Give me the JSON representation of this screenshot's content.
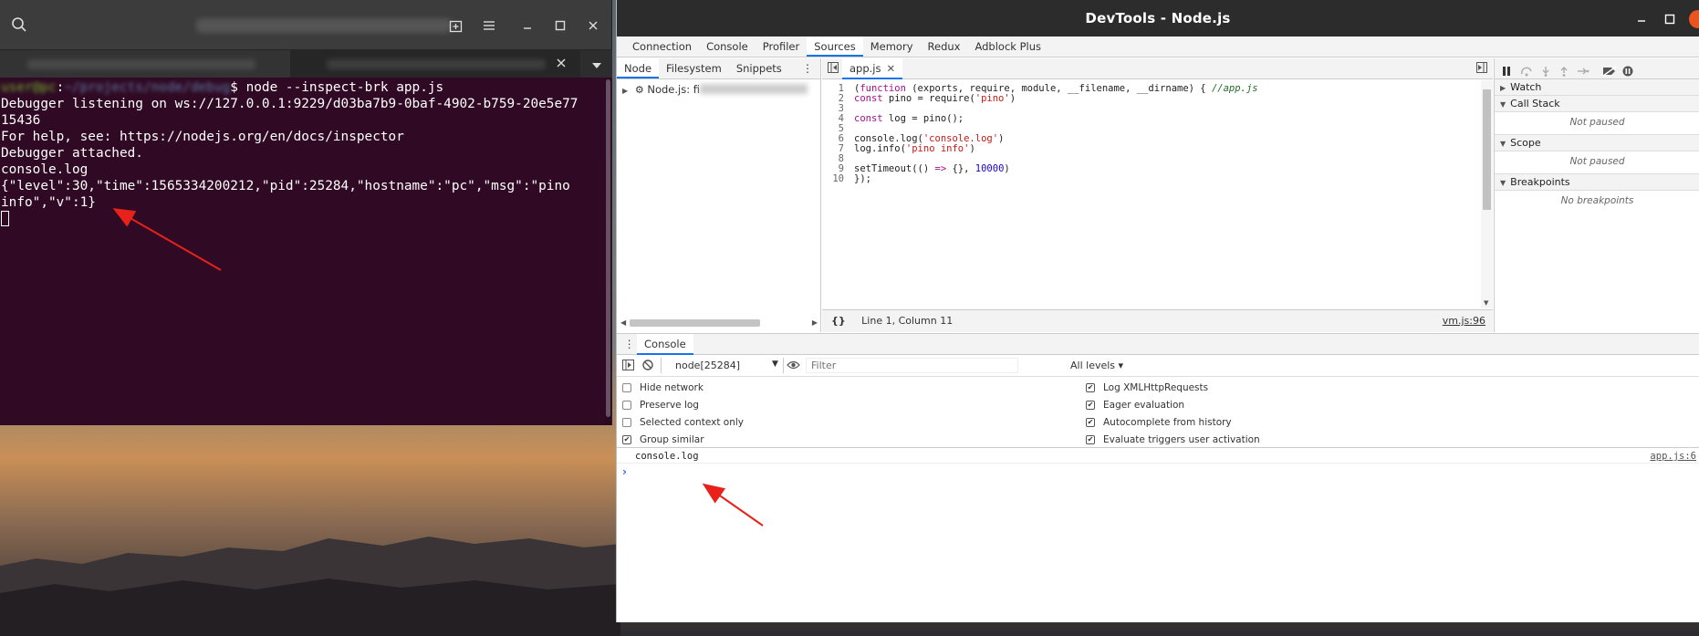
{
  "terminal": {
    "command": "$ node --inspect-brk app.js",
    "output_lines": [
      "Debugger listening on ws://127.0.0.1:9229/d03ba7b9-0baf-4902-b759-20e5e77",
      "15436",
      "For help, see: https://nodejs.org/en/docs/inspector",
      "Debugger attached.",
      "console.log",
      "{\"level\":30,\"time\":1565334200212,\"pid\":25284,\"hostname\":\"pc\",\"msg\":\"pino",
      "info\",\"v\":1}"
    ]
  },
  "devtools": {
    "window_title": "DevTools - Node.js",
    "main_tabs": [
      "Connection",
      "Console",
      "Profiler",
      "Sources",
      "Memory",
      "Redux",
      "Adblock Plus"
    ],
    "active_main_tab": "Sources",
    "navigator": {
      "tabs": [
        "Node",
        "Filesystem",
        "Snippets"
      ],
      "tree_item": "Node.js: fi"
    },
    "editor": {
      "file_tab": "app.js",
      "line_numbers": [
        "1",
        "2",
        "3",
        "4",
        "5",
        "6",
        "7",
        "8",
        "9",
        "10"
      ],
      "status_position": "Line 1, Column 11",
      "status_source": "vm.js:96"
    },
    "debugger_sidebar": {
      "watch": "Watch",
      "call_stack": "Call Stack",
      "call_stack_body": "Not paused",
      "scope": "Scope",
      "scope_body": "Not paused",
      "breakpoints": "Breakpoints",
      "breakpoints_body": "No breakpoints"
    },
    "drawer": {
      "tab": "Console",
      "context": "node[25284]",
      "filter_placeholder": "Filter",
      "levels": "All levels ▾",
      "settings_left": [
        {
          "label": "Hide network",
          "checked": false
        },
        {
          "label": "Preserve log",
          "checked": false
        },
        {
          "label": "Selected context only",
          "checked": false
        },
        {
          "label": "Group similar",
          "checked": true
        }
      ],
      "settings_right": [
        {
          "label": "Log XMLHttpRequests",
          "checked": true
        },
        {
          "label": "Eager evaluation",
          "checked": true
        },
        {
          "label": "Autocomplete from history",
          "checked": true
        },
        {
          "label": "Evaluate triggers user activation",
          "checked": true
        }
      ],
      "message": "console.log",
      "message_source": "app.js:6"
    }
  },
  "colors": {
    "terminal_bg": "#300a24",
    "accent_blue": "#1a73e8",
    "annotation_red": "#e8211a",
    "ubuntu_orange": "#e95420"
  }
}
